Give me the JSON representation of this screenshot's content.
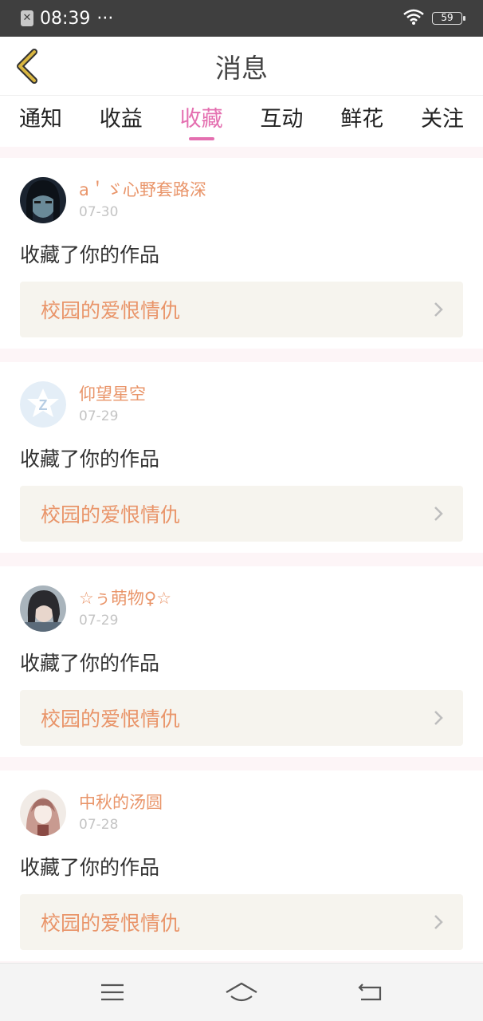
{
  "status": {
    "time": "08:39",
    "dots": "···",
    "battery": "59"
  },
  "header": {
    "title": "消息"
  },
  "tabs": [
    {
      "label": "通知",
      "active": false
    },
    {
      "label": "收益",
      "active": false
    },
    {
      "label": "收藏",
      "active": true
    },
    {
      "label": "互动",
      "active": false
    },
    {
      "label": "鲜花",
      "active": false
    },
    {
      "label": "关注",
      "active": false
    }
  ],
  "items": [
    {
      "username": "a＇ゞ心野套路深",
      "date": "07-30",
      "action": "收藏了你的作品",
      "work": "校园的爱恨情仇",
      "avatar": "avatar-dark-hair"
    },
    {
      "username": "仰望星空",
      "date": "07-29",
      "action": "收藏了你的作品",
      "work": "校园的爱恨情仇",
      "avatar": "avatar-default-z"
    },
    {
      "username": "☆ぅ萌物♀☆",
      "date": "07-29",
      "action": "收藏了你的作品",
      "work": "校园的爱恨情仇",
      "avatar": "avatar-girl-photo"
    },
    {
      "username": "中秋的汤圆",
      "date": "07-28",
      "action": "收藏了你的作品",
      "work": "校园的爱恨情仇",
      "avatar": "avatar-anime-girl"
    }
  ],
  "colors": {
    "accent": "#e46fb0",
    "name": "#e9956a",
    "date": "#c4c4c4",
    "back": "#d9b640"
  }
}
